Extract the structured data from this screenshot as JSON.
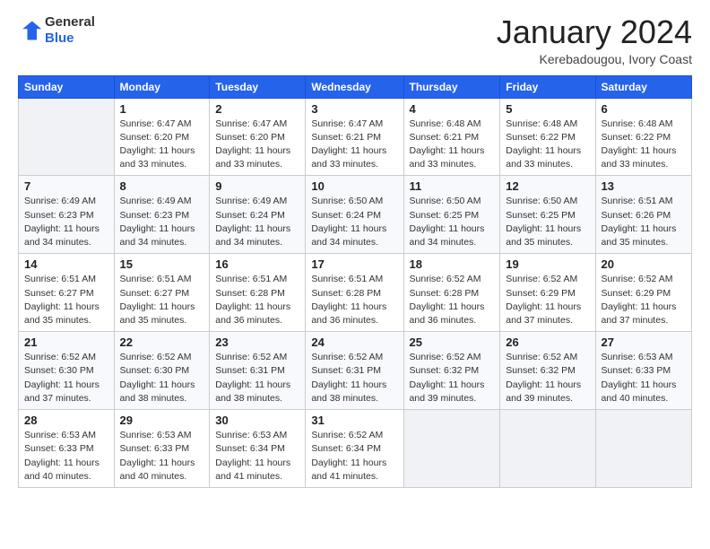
{
  "logo": {
    "general": "General",
    "blue": "Blue"
  },
  "header": {
    "month": "January 2024",
    "location": "Kerebadougou, Ivory Coast"
  },
  "days_of_week": [
    "Sunday",
    "Monday",
    "Tuesday",
    "Wednesday",
    "Thursday",
    "Friday",
    "Saturday"
  ],
  "weeks": [
    [
      {
        "day": "",
        "detail": ""
      },
      {
        "day": "1",
        "detail": "Sunrise: 6:47 AM\nSunset: 6:20 PM\nDaylight: 11 hours\nand 33 minutes."
      },
      {
        "day": "2",
        "detail": "Sunrise: 6:47 AM\nSunset: 6:20 PM\nDaylight: 11 hours\nand 33 minutes."
      },
      {
        "day": "3",
        "detail": "Sunrise: 6:47 AM\nSunset: 6:21 PM\nDaylight: 11 hours\nand 33 minutes."
      },
      {
        "day": "4",
        "detail": "Sunrise: 6:48 AM\nSunset: 6:21 PM\nDaylight: 11 hours\nand 33 minutes."
      },
      {
        "day": "5",
        "detail": "Sunrise: 6:48 AM\nSunset: 6:22 PM\nDaylight: 11 hours\nand 33 minutes."
      },
      {
        "day": "6",
        "detail": "Sunrise: 6:48 AM\nSunset: 6:22 PM\nDaylight: 11 hours\nand 33 minutes."
      }
    ],
    [
      {
        "day": "7",
        "detail": "Sunrise: 6:49 AM\nSunset: 6:23 PM\nDaylight: 11 hours\nand 34 minutes."
      },
      {
        "day": "8",
        "detail": "Sunrise: 6:49 AM\nSunset: 6:23 PM\nDaylight: 11 hours\nand 34 minutes."
      },
      {
        "day": "9",
        "detail": "Sunrise: 6:49 AM\nSunset: 6:24 PM\nDaylight: 11 hours\nand 34 minutes."
      },
      {
        "day": "10",
        "detail": "Sunrise: 6:50 AM\nSunset: 6:24 PM\nDaylight: 11 hours\nand 34 minutes."
      },
      {
        "day": "11",
        "detail": "Sunrise: 6:50 AM\nSunset: 6:25 PM\nDaylight: 11 hours\nand 34 minutes."
      },
      {
        "day": "12",
        "detail": "Sunrise: 6:50 AM\nSunset: 6:25 PM\nDaylight: 11 hours\nand 35 minutes."
      },
      {
        "day": "13",
        "detail": "Sunrise: 6:51 AM\nSunset: 6:26 PM\nDaylight: 11 hours\nand 35 minutes."
      }
    ],
    [
      {
        "day": "14",
        "detail": "Sunrise: 6:51 AM\nSunset: 6:27 PM\nDaylight: 11 hours\nand 35 minutes."
      },
      {
        "day": "15",
        "detail": "Sunrise: 6:51 AM\nSunset: 6:27 PM\nDaylight: 11 hours\nand 35 minutes."
      },
      {
        "day": "16",
        "detail": "Sunrise: 6:51 AM\nSunset: 6:28 PM\nDaylight: 11 hours\nand 36 minutes."
      },
      {
        "day": "17",
        "detail": "Sunrise: 6:51 AM\nSunset: 6:28 PM\nDaylight: 11 hours\nand 36 minutes."
      },
      {
        "day": "18",
        "detail": "Sunrise: 6:52 AM\nSunset: 6:28 PM\nDaylight: 11 hours\nand 36 minutes."
      },
      {
        "day": "19",
        "detail": "Sunrise: 6:52 AM\nSunset: 6:29 PM\nDaylight: 11 hours\nand 37 minutes."
      },
      {
        "day": "20",
        "detail": "Sunrise: 6:52 AM\nSunset: 6:29 PM\nDaylight: 11 hours\nand 37 minutes."
      }
    ],
    [
      {
        "day": "21",
        "detail": "Sunrise: 6:52 AM\nSunset: 6:30 PM\nDaylight: 11 hours\nand 37 minutes."
      },
      {
        "day": "22",
        "detail": "Sunrise: 6:52 AM\nSunset: 6:30 PM\nDaylight: 11 hours\nand 38 minutes."
      },
      {
        "day": "23",
        "detail": "Sunrise: 6:52 AM\nSunset: 6:31 PM\nDaylight: 11 hours\nand 38 minutes."
      },
      {
        "day": "24",
        "detail": "Sunrise: 6:52 AM\nSunset: 6:31 PM\nDaylight: 11 hours\nand 38 minutes."
      },
      {
        "day": "25",
        "detail": "Sunrise: 6:52 AM\nSunset: 6:32 PM\nDaylight: 11 hours\nand 39 minutes."
      },
      {
        "day": "26",
        "detail": "Sunrise: 6:52 AM\nSunset: 6:32 PM\nDaylight: 11 hours\nand 39 minutes."
      },
      {
        "day": "27",
        "detail": "Sunrise: 6:53 AM\nSunset: 6:33 PM\nDaylight: 11 hours\nand 40 minutes."
      }
    ],
    [
      {
        "day": "28",
        "detail": "Sunrise: 6:53 AM\nSunset: 6:33 PM\nDaylight: 11 hours\nand 40 minutes."
      },
      {
        "day": "29",
        "detail": "Sunrise: 6:53 AM\nSunset: 6:33 PM\nDaylight: 11 hours\nand 40 minutes."
      },
      {
        "day": "30",
        "detail": "Sunrise: 6:53 AM\nSunset: 6:34 PM\nDaylight: 11 hours\nand 41 minutes."
      },
      {
        "day": "31",
        "detail": "Sunrise: 6:52 AM\nSunset: 6:34 PM\nDaylight: 11 hours\nand 41 minutes."
      },
      {
        "day": "",
        "detail": ""
      },
      {
        "day": "",
        "detail": ""
      },
      {
        "day": "",
        "detail": ""
      }
    ]
  ]
}
